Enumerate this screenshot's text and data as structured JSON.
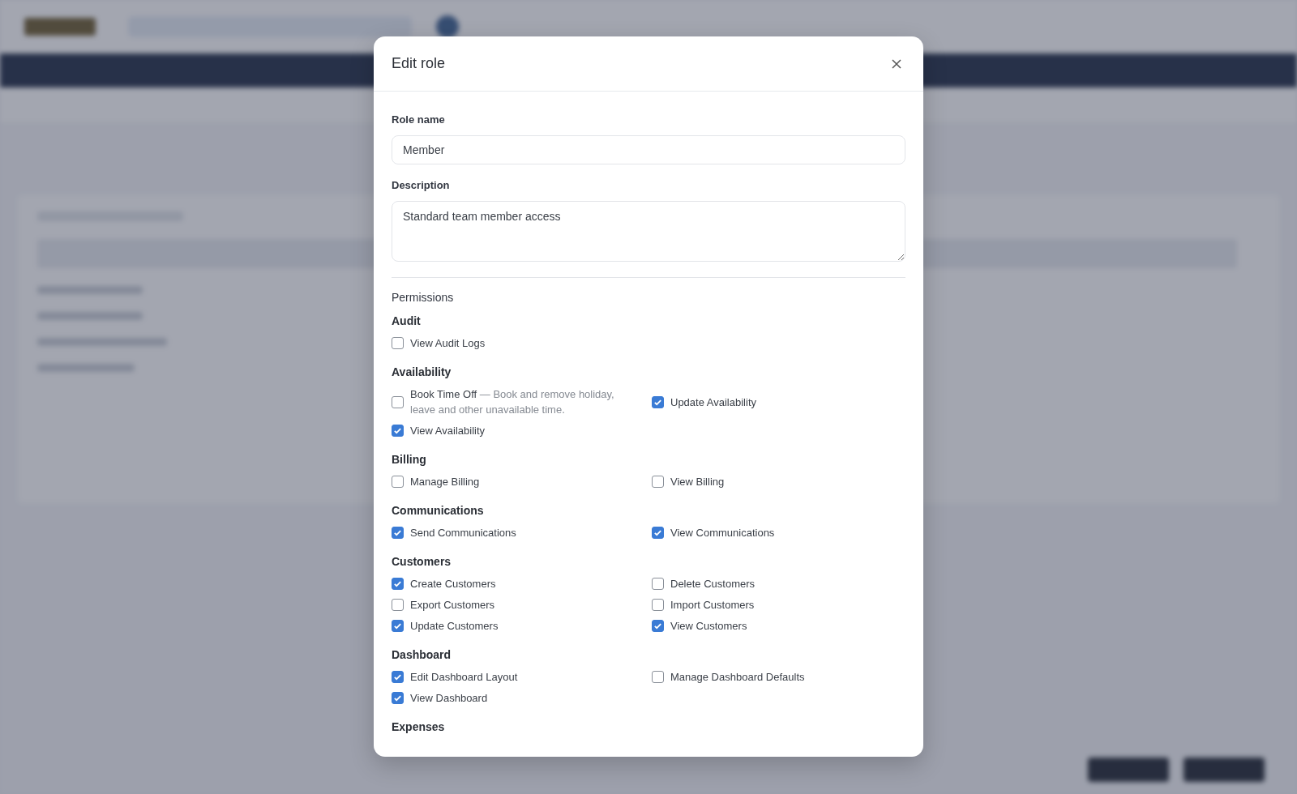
{
  "modal": {
    "title": "Edit role",
    "fields": [
      {
        "label": "Role name",
        "kind": "input",
        "value": "Member"
      },
      {
        "label": "Description",
        "kind": "textarea",
        "value": "Standard team member access"
      }
    ],
    "permissions": {
      "title": "Permissions",
      "groups": [
        {
          "name": "Audit",
          "items": [
            {
              "label": "View Audit Logs",
              "checked": false
            }
          ]
        },
        {
          "name": "Availability",
          "items": [
            {
              "label": "Book Time Off",
              "description": "— Book and remove holiday, leave and other unavailable time.",
              "checked": false
            },
            {
              "label": "Update Availability",
              "checked": true
            },
            {
              "label": "View Availability",
              "checked": true
            }
          ]
        },
        {
          "name": "Billing",
          "items": [
            {
              "label": "Manage Billing",
              "checked": false
            },
            {
              "label": "View Billing",
              "checked": false
            }
          ]
        },
        {
          "name": "Communications",
          "items": [
            {
              "label": "Send Communications",
              "checked": true
            },
            {
              "label": "View Communications",
              "checked": true
            }
          ]
        },
        {
          "name": "Customers",
          "items": [
            {
              "label": "Create Customers",
              "checked": true
            },
            {
              "label": "Delete Customers",
              "checked": false
            },
            {
              "label": "Export Customers",
              "checked": false
            },
            {
              "label": "Import Customers",
              "checked": false
            },
            {
              "label": "Update Customers",
              "checked": true
            },
            {
              "label": "View Customers",
              "checked": true
            }
          ]
        },
        {
          "name": "Dashboard",
          "items": [
            {
              "label": "Edit Dashboard Layout",
              "checked": true
            },
            {
              "label": "Manage Dashboard Defaults",
              "checked": false
            },
            {
              "label": "View Dashboard",
              "checked": true
            }
          ]
        },
        {
          "name": "Expenses"
        }
      ]
    }
  }
}
